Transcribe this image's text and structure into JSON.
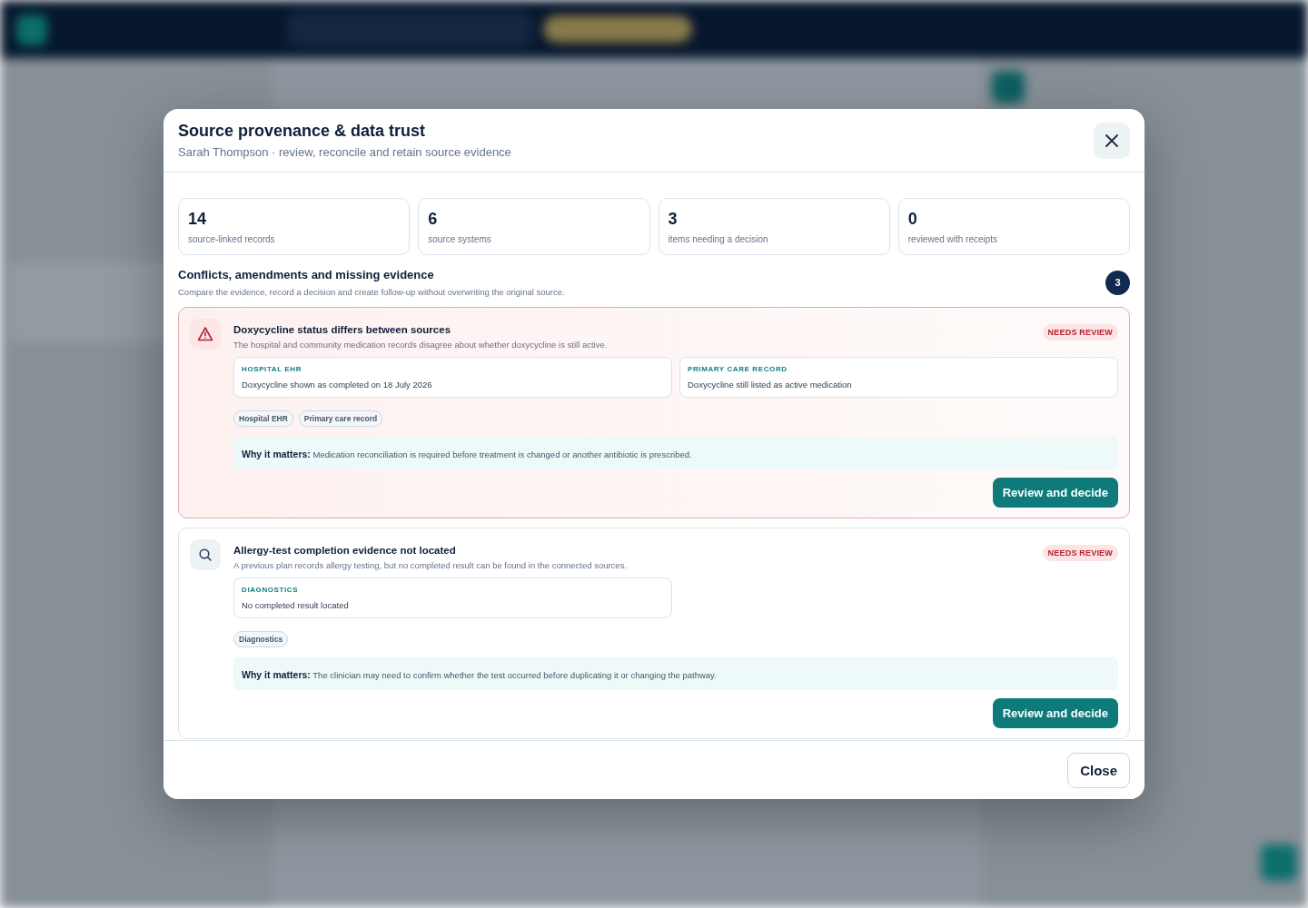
{
  "dialog": {
    "title": "Source provenance & data trust",
    "subtitle": "Sarah Thompson · review, reconcile and retain source evidence",
    "close_label": "Close"
  },
  "stats": [
    {
      "value": "14",
      "label": "source-linked records"
    },
    {
      "value": "6",
      "label": "source systems"
    },
    {
      "value": "3",
      "label": "items needing a decision"
    },
    {
      "value": "0",
      "label": "reviewed with receipts"
    }
  ],
  "section": {
    "title": "Conflicts, amendments and missing evidence",
    "description": "Compare the evidence, record a decision and create follow-up without overwriting the original source.",
    "count": "3"
  },
  "issues": [
    {
      "kind": "conflict",
      "title": "Doxycycline status differs between sources",
      "description": "The hospital and community medication records disagree about whether doxycycline is still active.",
      "status": "NEEDS REVIEW",
      "evidence": [
        {
          "source": "HOSPITAL EHR",
          "text": "Doxycycline shown as completed on 18 July 2026"
        },
        {
          "source": "PRIMARY CARE RECORD",
          "text": "Doxycycline still listed as active medication"
        }
      ],
      "tags": [
        "Hospital EHR",
        "Primary care record"
      ],
      "why_label": "Why it matters:",
      "why": "Medication reconciliation is required before treatment is changed or another antibiotic is prescribed.",
      "action": "Review and decide"
    },
    {
      "kind": "missing",
      "title": "Allergy-test completion evidence not located",
      "description": "A previous plan records allergy testing, but no completed result can be found in the connected sources.",
      "status": "NEEDS REVIEW",
      "evidence": [
        {
          "source": "DIAGNOSTICS",
          "text": "No completed result located"
        }
      ],
      "tags": [
        "Diagnostics"
      ],
      "why_label": "Why it matters:",
      "why": "The clinician may need to confirm whether the test occurred before duplicating it or changing the pathway.",
      "action": "Review and decide"
    }
  ]
}
